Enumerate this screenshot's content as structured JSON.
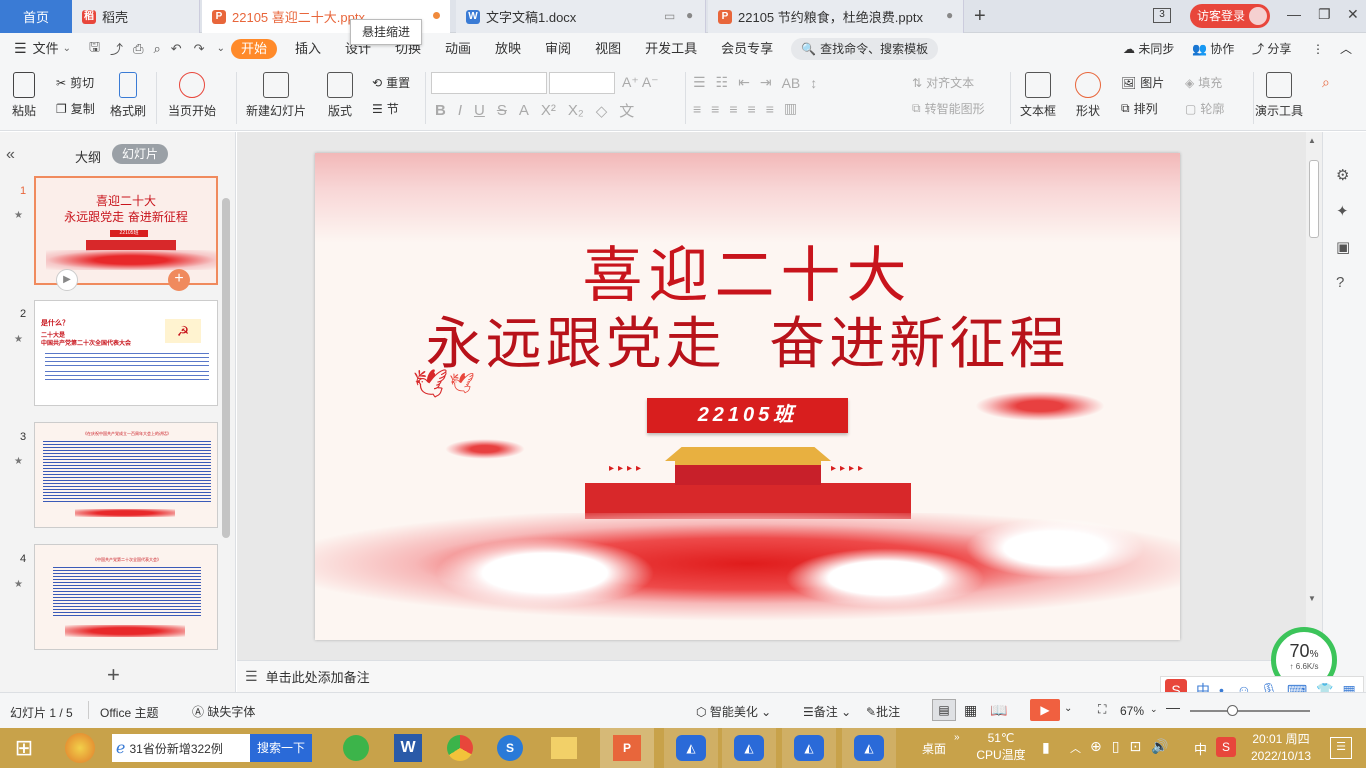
{
  "tabs": {
    "home": "首页",
    "daoke": "稻壳",
    "active_doc": "22105 喜迎二十大.pptx",
    "tooltip": "悬挂缩进",
    "doc2": "文字文稿1.docx",
    "doc3": "22105 节约粮食，杜绝浪费.pptx",
    "new_tab": "+",
    "page_count": "3",
    "visitor_login": "访客登录"
  },
  "menu": {
    "file": "文件",
    "items": [
      "开始",
      "插入",
      "设计",
      "切换",
      "动画",
      "放映",
      "审阅",
      "视图",
      "开发工具",
      "会员专享"
    ],
    "search": "查找命令、搜索模板",
    "unsync": "未同步",
    "collab": "协作",
    "share": "分享"
  },
  "ribbon": {
    "paste": "粘贴",
    "cut": "剪切",
    "copy": "复制",
    "format_painter": "格式刷",
    "play_from_current": "当页开始",
    "new_slide": "新建幻灯片",
    "layout": "版式",
    "section": "节",
    "reset": "重置",
    "text_direction": "对齐文本",
    "to_smartart": "转智能图形",
    "textbox": "文本框",
    "shape": "形状",
    "picture": "图片",
    "fill": "填充",
    "arrange": "排列",
    "outline": "轮廓",
    "presentation_tools": "演示工具"
  },
  "left_panel": {
    "outline_tab": "大纲",
    "slides_tab": "幻灯片",
    "slides": [
      {
        "num": "1",
        "title": "喜迎二十大",
        "subtitle": "永远跟党走  奋进新征程",
        "badge": "22105班"
      },
      {
        "num": "2",
        "title": "是什么？",
        "subtitle": "二十大是",
        "line": "中国共产党第二十次全国代表大会"
      },
      {
        "num": "3",
        "title": "《在庆祝中国共产党成立一百周年大会上的讲话》"
      },
      {
        "num": "4",
        "title": "《中国共产党第二十次全国代表大会》"
      }
    ],
    "add": "+"
  },
  "slide": {
    "title1": "喜迎二十大",
    "title2": "永远跟党走  奋进新征程",
    "badge": "22105班"
  },
  "notes_placeholder": "单击此处添加备注",
  "status": {
    "slide_pos": "幻灯片 1 / 5",
    "theme": "Office 主题",
    "missing_font": "缺失字体",
    "beautify": "智能美化",
    "notes": "备注",
    "comments": "批注",
    "zoom": "67%"
  },
  "perf": {
    "percent": "70",
    "unit": "%",
    "speed": "6.6K/s"
  },
  "ime": {
    "lang": "中"
  },
  "taskbar": {
    "news": "31省份新增322例",
    "search_btn": "搜索一下",
    "desktop": "桌面",
    "temp": "51℃",
    "temp_label": "CPU温度",
    "ime": "中",
    "time": "20:01 周四",
    "date": "2022/10/13"
  },
  "colors": {
    "accent_orange": "#ff8a2a",
    "title_red": "#c8141c",
    "badge_red": "#d81e1e"
  }
}
